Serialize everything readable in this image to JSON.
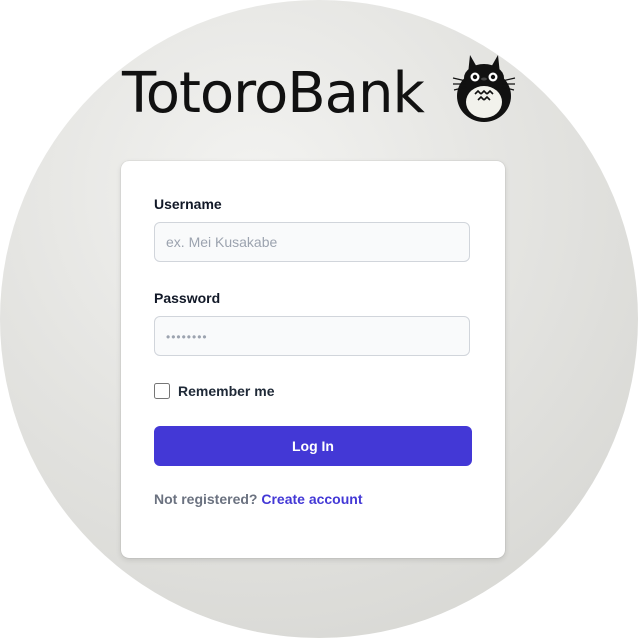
{
  "brand": {
    "title": "TotoroBank",
    "logo_icon": "totoro-icon"
  },
  "form": {
    "username_label": "Username",
    "username_placeholder": "ex. Mei Kusakabe",
    "username_value": "",
    "password_label": "Password",
    "password_placeholder": "••••••••",
    "password_value": "",
    "remember_label": "Remember me",
    "remember_checked": false,
    "login_label": "Log In",
    "register_prompt": "Not registered?",
    "register_link": "Create account"
  },
  "colors": {
    "accent": "#4338d6",
    "background_circle": "#dcdcd9",
    "card": "#ffffff"
  }
}
